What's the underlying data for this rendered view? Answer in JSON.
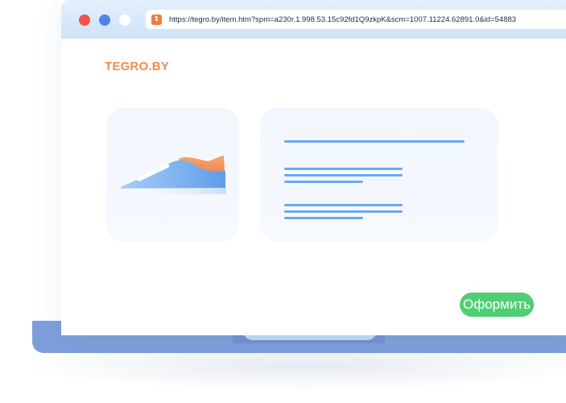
{
  "browser": {
    "url": "https://tegro.by/item.htm?spm=a230r.1.998.53.15c92fd1Q9zkpK&scm=1007.11224.62891.0&id=54883",
    "favicon_letter": "t",
    "favicon_color": "#ef7d3c",
    "window_dots": [
      "red",
      "blue",
      "white"
    ]
  },
  "page": {
    "brand": "TEGRO.BY",
    "brand_color": "#ef8c4c",
    "product_image_icon": "sneaker-icon",
    "checkout_button_label": "Оформить",
    "accent_color": "#4fcf73"
  }
}
